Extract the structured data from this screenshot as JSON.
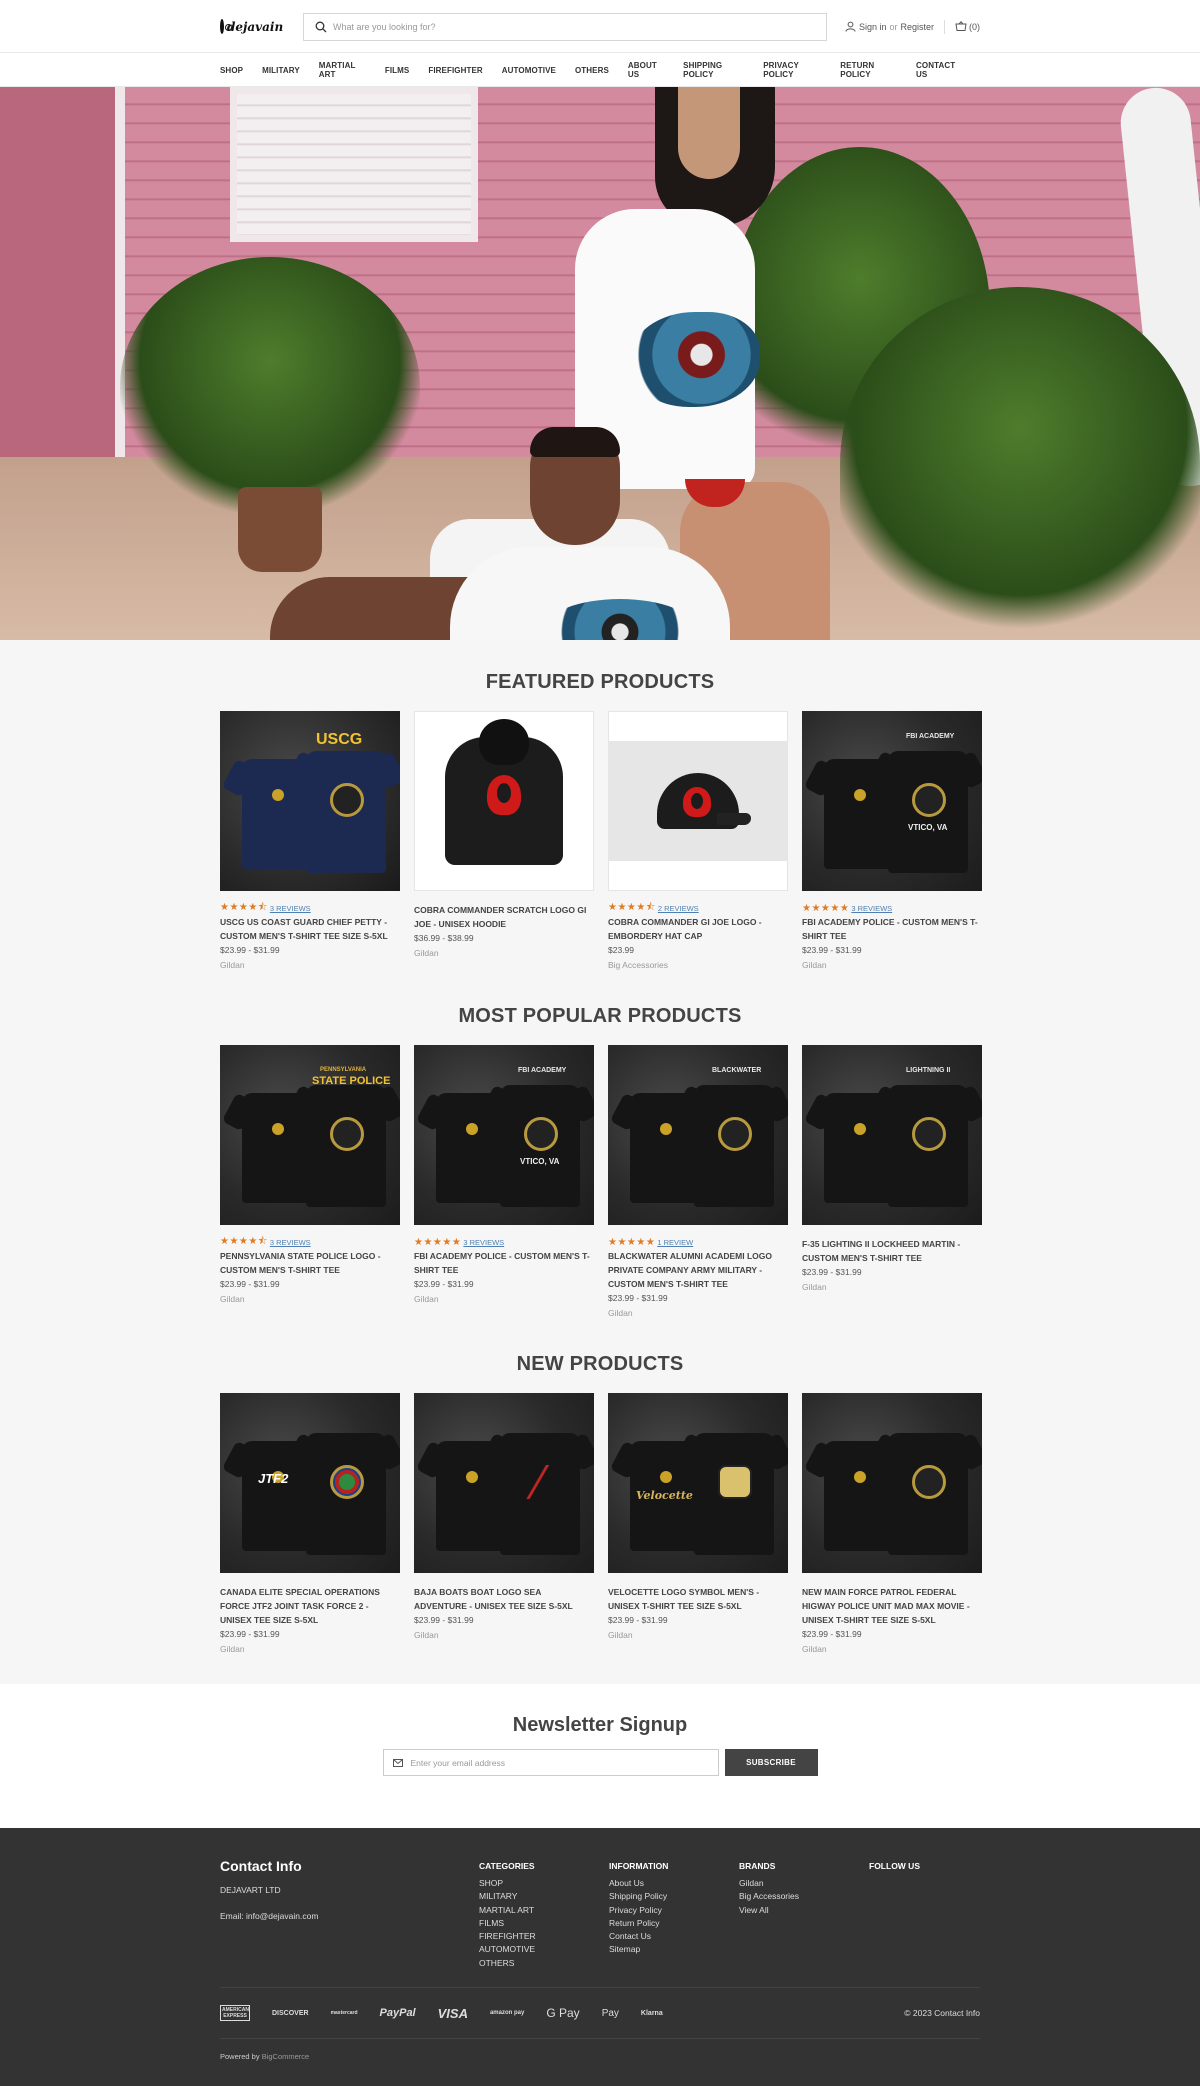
{
  "header": {
    "logo_text": "dejavain",
    "search_placeholder": "What are you looking for?",
    "sign_in": "Sign in",
    "or": "or",
    "register": "Register",
    "cart_count": "(0)"
  },
  "nav": [
    "SHOP",
    "MILITARY",
    "MARTIAL ART",
    "FILMS",
    "FIREFIGHTER",
    "AUTOMOTIVE",
    "OTHERS",
    "ABOUT US",
    "SHIPPING POLICY",
    "PRIVACY POLICY",
    "RETURN POLICY",
    "CONTACT US"
  ],
  "featured": {
    "title": "FEATURED PRODUCTS",
    "items": [
      {
        "stars": "★★★★⯪",
        "reviews": "3 REVIEWS",
        "name": "USCG US COAST GUARD CHIEF PETTY - CUSTOM MEN'S T-SHIRT TEE SIZE S-5XL",
        "price": "$23.99 - $31.99",
        "brand": "Gildan",
        "art": "USCG"
      },
      {
        "stars": "",
        "reviews": "",
        "name": "COBRA COMMANDER SCRATCH LOGO GI JOE - UNISEX HOODIE",
        "price": "$36.99 - $38.99",
        "brand": "Gildan"
      },
      {
        "stars": "★★★★⯪",
        "reviews": "2 REVIEWS",
        "name": "COBRA COMMANDER GI JOE LOGO - EMBORDERY HAT CAP",
        "price": "$23.99",
        "brand": "Big Accessories"
      },
      {
        "stars": "★★★★★",
        "reviews": "3 REVIEWS",
        "name": "FBI ACADEMY POLICE - CUSTOM MEN'S T-SHIRT TEE",
        "price": "$23.99 - $31.99",
        "brand": "Gildan",
        "art": "FBI ACADEMY",
        "art2": "VTICO, VA"
      }
    ]
  },
  "popular": {
    "title": "MOST POPULAR PRODUCTS",
    "items": [
      {
        "stars": "★★★★⯪",
        "reviews": "3 REVIEWS",
        "name": "PENNSYLVANIA STATE POLICE LOGO - CUSTOM MEN'S T-SHIRT TEE",
        "price": "$23.99 - $31.99",
        "brand": "Gildan",
        "art": "PENNSYLVANIA",
        "art2": "STATE POLICE"
      },
      {
        "stars": "★★★★★",
        "reviews": "3 REVIEWS",
        "name": "FBI ACADEMY POLICE - CUSTOM MEN'S T-SHIRT TEE",
        "price": "$23.99 - $31.99",
        "brand": "Gildan",
        "art": "FBI ACADEMY",
        "art2": "VTICO, VA"
      },
      {
        "stars": "★★★★★",
        "reviews": "1 REVIEW",
        "name": "BLACKWATER ALUMNI ACADEMI LOGO PRIVATE COMPANY ARMY MILITARY - CUSTOM MEN'S T-SHIRT TEE",
        "price": "$23.99 - $31.99",
        "brand": "Gildan",
        "art": "BLACKWATER"
      },
      {
        "stars": "",
        "reviews": "",
        "name": "F-35 LIGHTING II LOCKHEED MARTIN - CUSTOM MEN'S T-SHIRT TEE",
        "price": "$23.99 - $31.99",
        "brand": "Gildan",
        "art": "LIGHTNING II"
      }
    ]
  },
  "newp": {
    "title": "NEW PRODUCTS",
    "items": [
      {
        "name": "CANADA ELITE SPECIAL OPERATIONS FORCE JTF2 JOINT TASK FORCE 2 - UNISEX TEE SIZE S-5XL",
        "price": "$23.99 - $31.99",
        "brand": "Gildan",
        "art": "JTF2"
      },
      {
        "name": "BAJA BOATS BOAT LOGO SEA ADVENTURE - UNISEX TEE SIZE S-5XL",
        "price": "$23.99 - $31.99",
        "brand": "Gildan"
      },
      {
        "name": "VELOCETTE LOGO SYMBOL MEN'S - UNISEX T-SHIRT TEE SIZE S-5XL",
        "price": "$23.99 - $31.99",
        "brand": "Gildan",
        "art": "Velocette"
      },
      {
        "name": "NEW MAIN FORCE PATROL FEDERAL HIGWAY POLICE UNIT MAD MAX MOVIE - UNISEX T-SHIRT TEE SIZE S-5XL",
        "price": "$23.99 - $31.99",
        "brand": "Gildan"
      }
    ]
  },
  "newsletter": {
    "title": "Newsletter Signup",
    "placeholder": "Enter your email address",
    "button": "SUBSCRIBE"
  },
  "footer": {
    "contact_title": "Contact Info",
    "company": "DEJAVART LTD",
    "email": "Email: info@dejavain.com",
    "categories_title": "CATEGORIES",
    "categories": [
      "SHOP",
      "MILITARY",
      "MARTIAL ART",
      "FILMS",
      "FIREFIGHTER",
      "AUTOMOTIVE",
      "OTHERS"
    ],
    "information_title": "INFORMATION",
    "information": [
      "About Us",
      "Shipping Policy",
      "Privacy Policy",
      "Return Policy",
      "Contact Us",
      "Sitemap"
    ],
    "brands_title": "BRANDS",
    "brands": [
      "Gildan",
      "Big Accessories",
      "View All"
    ],
    "follow_title": "FOLLOW US",
    "payments": [
      "AMERICAN EXPRESS",
      "DISCOVER",
      "mastercard",
      "PayPal",
      "VISA",
      "amazon pay",
      "G Pay",
      "Pay",
      "Klarna"
    ],
    "copyright": "© 2023 Contact Info",
    "powered_by": "Powered by",
    "powered_link": "BigCommerce"
  },
  "colors": {
    "star": "#e07b24",
    "review_link": "#4f7fb0",
    "footer_bg": "#333333",
    "subscribe_bg": "#444444"
  }
}
